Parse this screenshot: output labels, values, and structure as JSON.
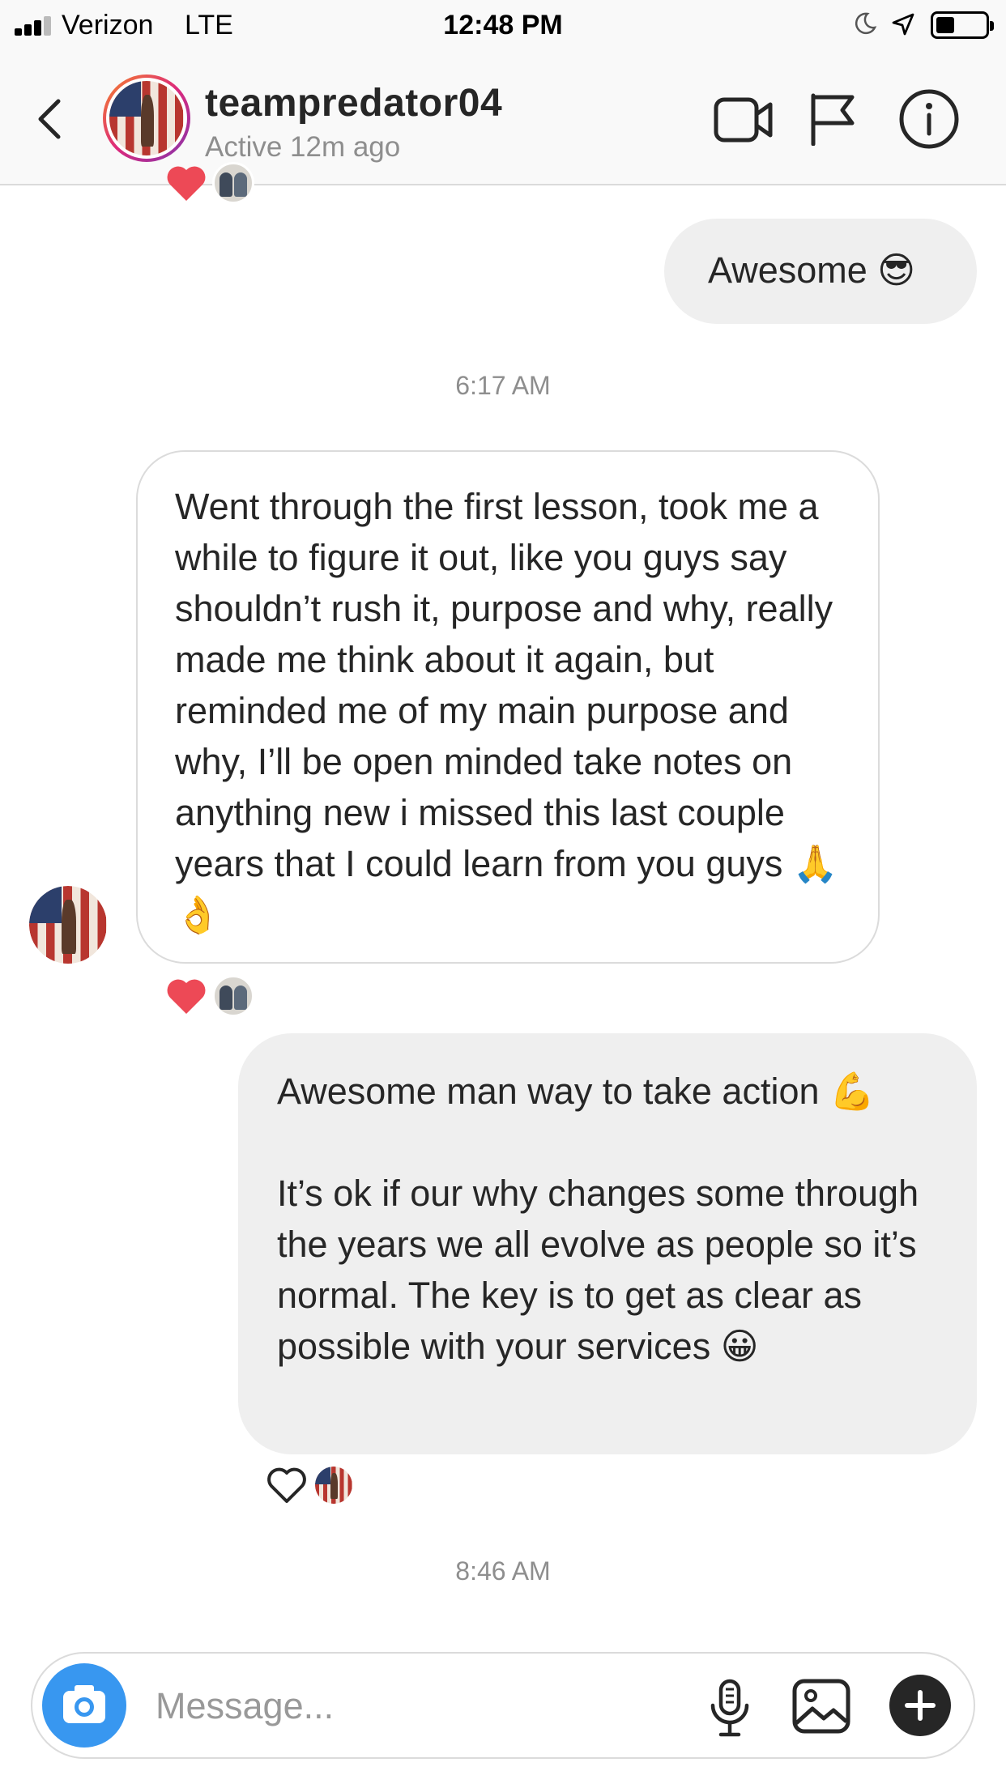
{
  "status_bar": {
    "carrier": "Verizon",
    "network": "LTE",
    "time": "12:48 PM"
  },
  "header": {
    "username": "teampredator04",
    "active_status": "Active 12m ago",
    "icons": [
      "back-icon",
      "video-call-icon",
      "flag-icon",
      "info-icon"
    ]
  },
  "messages": [
    {
      "id": "m1",
      "side": "sent",
      "text": "Awesome 😎"
    },
    {
      "id": "t1",
      "type": "timestamp",
      "text": "6:17 AM"
    },
    {
      "id": "m2",
      "side": "received",
      "text": "Went through the first lesson, took me a while to figure it out, like you guys say shouldn’t rush it, purpose and why, really made me think about it again, but reminded me of my main purpose and why, I’ll be open minded take notes on anything new i missed this last couple years that I could learn from you guys 🙏 👌",
      "reactions": [
        "heart-filled",
        "avatar"
      ]
    },
    {
      "id": "m3",
      "side": "sent",
      "text": "Awesome man way to take action 💪\n\nIt’s ok if our why changes some through the years we all evolve as people so it’s normal. The key is to get as clear as possible with your services 😀",
      "reactions": [
        "heart-outline",
        "avatar"
      ]
    },
    {
      "id": "t2",
      "type": "timestamp",
      "text": "8:46 AM"
    }
  ],
  "composer": {
    "placeholder": "Message...",
    "value": "",
    "icons": [
      "camera-icon",
      "microphone-icon",
      "gallery-icon",
      "plus-icon"
    ]
  },
  "colors": {
    "accent": "#3897f0",
    "heart": "#ed4956",
    "sent_bubble": "#efefef",
    "received_border": "#dbdbdb",
    "secondary_text": "#8e8e8e"
  }
}
